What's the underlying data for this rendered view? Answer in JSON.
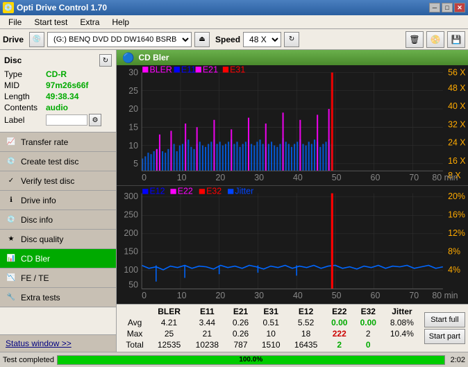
{
  "titleBar": {
    "title": "Opti Drive Control 1.70",
    "icon": "💿",
    "controls": [
      "─",
      "□",
      "✕"
    ]
  },
  "menuBar": {
    "items": [
      "File",
      "Start test",
      "Extra",
      "Help"
    ]
  },
  "driveBar": {
    "label": "Drive",
    "driveValue": "(G:)  BENQ DVD DD DW1640 BSRB",
    "speedLabel": "Speed",
    "speedValue": "48 X",
    "buttons": [
      "eject",
      "reset",
      "eraser",
      "cd",
      "save"
    ]
  },
  "disc": {
    "title": "Disc",
    "type_label": "Type",
    "type_value": "CD-R",
    "mid_label": "MID",
    "mid_value": "97m26s66f",
    "length_label": "Length",
    "length_value": "49:38.34",
    "contents_label": "Contents",
    "contents_value": "audio",
    "label_label": "Label"
  },
  "nav": {
    "items": [
      {
        "id": "transfer-rate",
        "label": "Transfer rate",
        "icon": "📈"
      },
      {
        "id": "create-test-disc",
        "label": "Create test disc",
        "icon": "💿"
      },
      {
        "id": "verify-test-disc",
        "label": "Verify test disc",
        "icon": "✓"
      },
      {
        "id": "drive-info",
        "label": "Drive info",
        "icon": "ℹ"
      },
      {
        "id": "disc-info",
        "label": "Disc info",
        "icon": "💿"
      },
      {
        "id": "disc-quality",
        "label": "Disc quality",
        "icon": "★"
      },
      {
        "id": "cd-bler",
        "label": "CD Bler",
        "icon": "📊",
        "active": true
      },
      {
        "id": "fe-te",
        "label": "FE / TE",
        "icon": "📉"
      },
      {
        "id": "extra-tests",
        "label": "Extra tests",
        "icon": "🔧"
      }
    ]
  },
  "chartTitle": "CD Bler",
  "topChart": {
    "legend": [
      {
        "label": "BLER",
        "color": "#ff00ff"
      },
      {
        "label": "E11",
        "color": "#0000ff"
      },
      {
        "label": "E21",
        "color": "#ff00ff"
      },
      {
        "label": "E31",
        "color": "#ff0000"
      }
    ],
    "yAxisMax": 30,
    "yAxisRight": [
      "56 X",
      "48 X",
      "40 X",
      "32 X",
      "24 X",
      "16 X",
      "8 X"
    ]
  },
  "bottomChart": {
    "legend": [
      {
        "label": "E12",
        "color": "#0000ff"
      },
      {
        "label": "E22",
        "color": "#ff00ff"
      },
      {
        "label": "E32",
        "color": "#ff0000"
      },
      {
        "label": "Jitter",
        "color": "#0000ff"
      }
    ],
    "yAxisMax": 300,
    "yAxisRight": [
      "20%",
      "16%",
      "12%",
      "8%",
      "4%"
    ]
  },
  "stats": {
    "headers": [
      "",
      "BLER",
      "E11",
      "E21",
      "E31",
      "E12",
      "E22",
      "E32",
      "Jitter"
    ],
    "rows": [
      {
        "label": "Avg",
        "values": [
          "4.21",
          "3.44",
          "0.26",
          "0.51",
          "5.52",
          "0.00",
          "0.00",
          "8.08%"
        ],
        "colors": [
          "black",
          "black",
          "black",
          "black",
          "black",
          "green",
          "green",
          "black"
        ]
      },
      {
        "label": "Max",
        "values": [
          "25",
          "21",
          "0.26",
          "10",
          "18",
          "222",
          "2",
          "10.4%"
        ],
        "colors": [
          "black",
          "black",
          "black",
          "black",
          "black",
          "red",
          "black",
          "black"
        ]
      },
      {
        "label": "Total",
        "values": [
          "12535",
          "10238",
          "787",
          "1510",
          "16435",
          "2",
          "0",
          ""
        ],
        "colors": [
          "black",
          "black",
          "black",
          "black",
          "black",
          "green",
          "green",
          "black"
        ]
      }
    ]
  },
  "buttons": {
    "startFull": "Start full",
    "startPart": "Start part"
  },
  "statusBar": {
    "text": "Test completed",
    "progress": 100.0,
    "progressText": "100.0%",
    "time": "2:02"
  },
  "statusWindow": "Status window >>"
}
